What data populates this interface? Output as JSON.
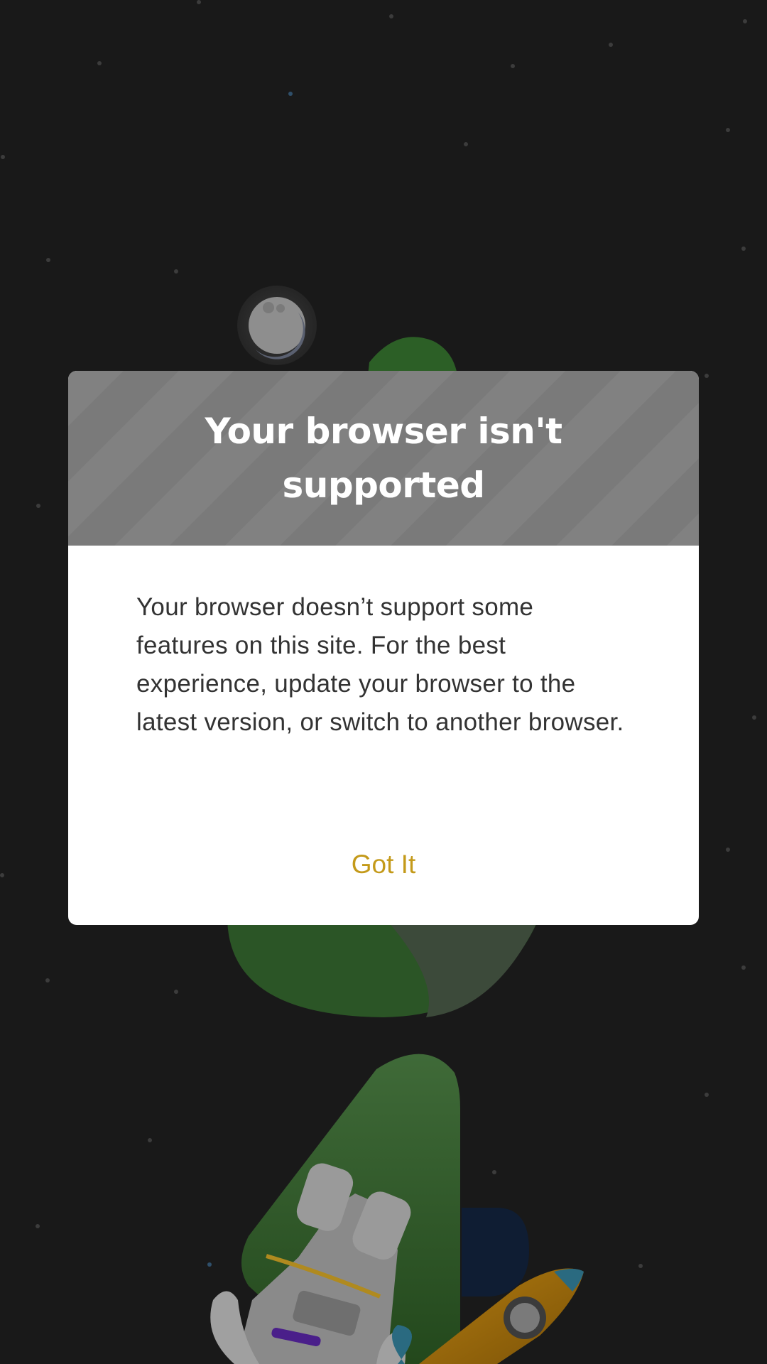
{
  "colors": {
    "background": "#191919",
    "header": "#7a7a7a",
    "accent": "#c49a1a",
    "planet_green": "#2f6a2a",
    "body_text": "#333333"
  },
  "background": {
    "icons": [
      "stars",
      "moon-icon",
      "planet-illustration",
      "astronaut-illustration",
      "rocket-illustration"
    ]
  },
  "dialog": {
    "title": "Your browser isn't supported",
    "message": "Your browser doesn’t support some features on this site. For the best experience, update your browser to the latest version, or switch to another browser.",
    "button_label": "Got It"
  }
}
